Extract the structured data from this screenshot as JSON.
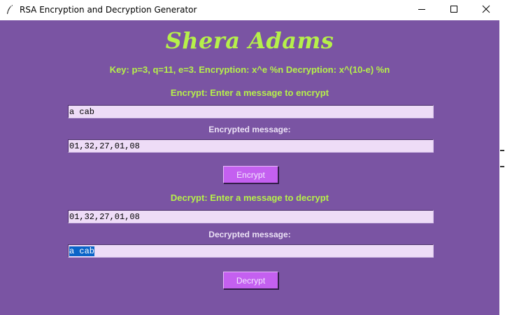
{
  "window": {
    "title": "RSA Encryption and Decryption Generator",
    "controls": {
      "minimize": "minimize",
      "maximize": "maximize",
      "close": "close"
    }
  },
  "app": {
    "name": "Shera Adams",
    "key_info": "Key: p=3, q=11, e=3. Encryption: x^e %n Decryption: x^(10-e) %n",
    "encrypt": {
      "prompt": "Encrypt: Enter a message to encrypt",
      "input_value": "a cab",
      "result_label": "Encrypted message:",
      "result_value": "01,32,27,01,08",
      "button_label": "Encrypt"
    },
    "decrypt": {
      "prompt": "Decrypt: Enter a message to decrypt",
      "input_value": "01,32,27,01,08",
      "result_label": "Decrypted message:",
      "result_value": "a cab",
      "button_label": "Decrypt"
    }
  },
  "colors": {
    "background": "#7a54a3",
    "accent_text": "#b6f04a",
    "field_bg": "#eedcf7",
    "button_bg": "#c460f0",
    "selection": "#0a64c8"
  },
  "icons": {
    "app": "feather-icon",
    "minimize": "minimize-icon",
    "maximize": "maximize-icon",
    "close": "close-icon"
  }
}
